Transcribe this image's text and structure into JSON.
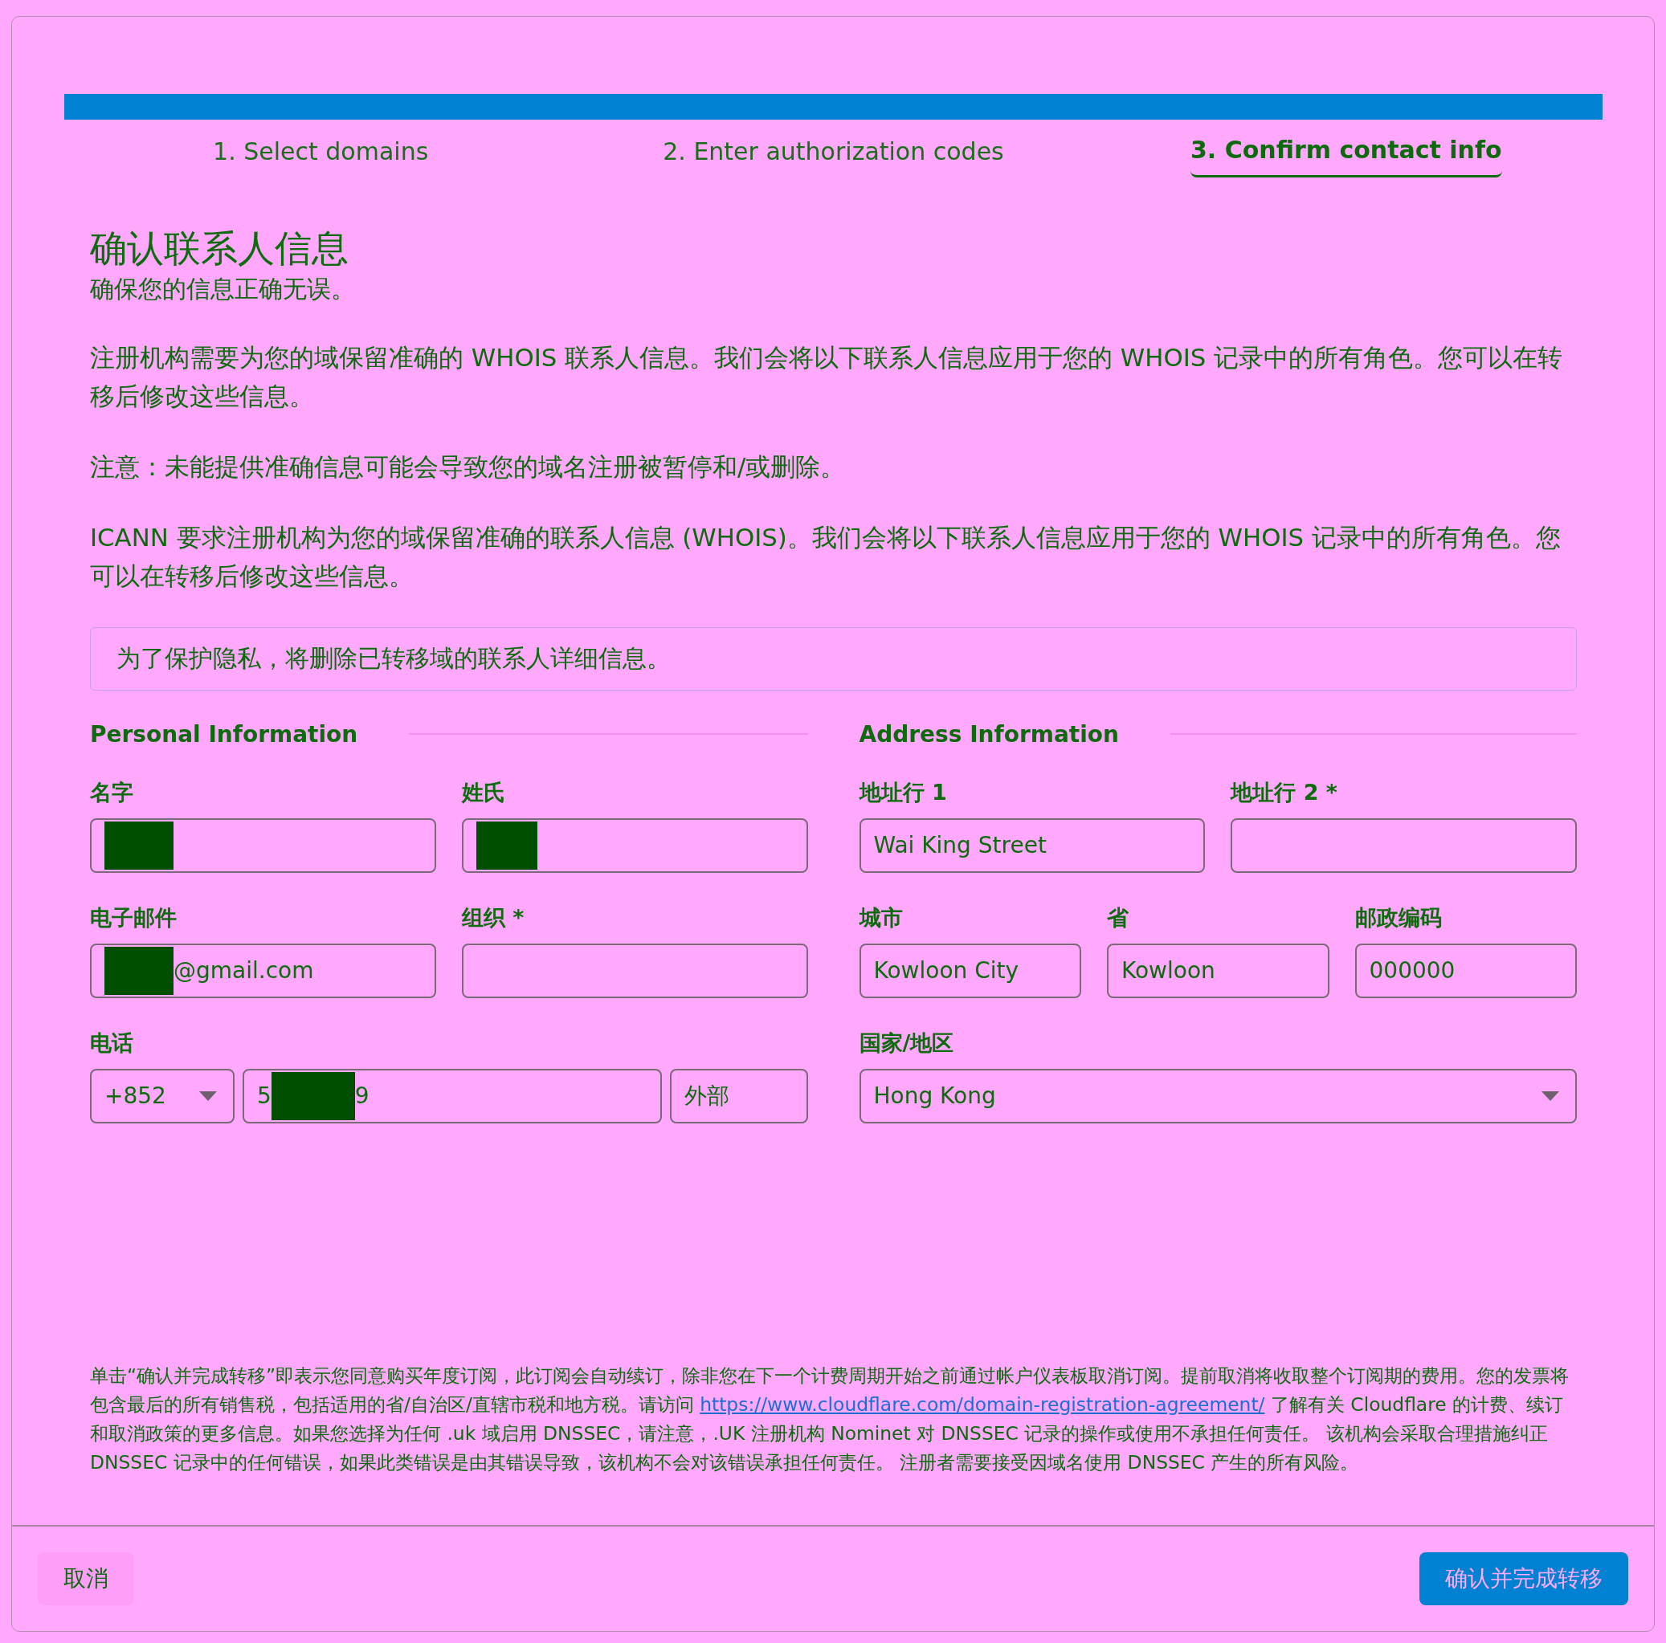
{
  "steps": [
    {
      "label": "1. Select domains",
      "selected": false
    },
    {
      "label": "2. Enter authorization codes",
      "selected": false
    },
    {
      "label": "3. Confirm contact info",
      "selected": true
    }
  ],
  "heading": "确认联系人信息",
  "subtitle": "确保您的信息正确无误。",
  "paragraphs": [
    "注册机构需要为您的域保留准确的 WHOIS 联系人信息。我们会将以下联系人信息应用于您的 WHOIS 记录中的所有角色。您可以在转移后修改这些信息。",
    "注意：未能提供准确信息可能会导致您的域名注册被暂停和/或删除。",
    "ICANN 要求注册机构为您的域保留准确的联系人信息 (WHOIS)。我们会将以下联系人信息应用于您的 WHOIS 记录中的所有角色。您可以在转移后修改这些信息。"
  ],
  "notice": "为了保护隐私，将删除已转移域的联系人详细信息。",
  "personal": {
    "title": "Personal Information",
    "first_name": {
      "label": "名字",
      "redacted": true
    },
    "last_name": {
      "label": "姓氏",
      "redacted": true
    },
    "email": {
      "label": "电子邮件",
      "redacted": true,
      "value": "@gmail.com"
    },
    "organization": {
      "label": "组织 *"
    },
    "phone": {
      "label": "电话",
      "country_code": "+852",
      "redacted": true,
      "visible_start": "5",
      "visible_end": "9",
      "extension_placeholder": "外部"
    }
  },
  "address": {
    "title": "Address Information",
    "line1": {
      "label": "地址行 1",
      "value": "Wai King Street"
    },
    "line2": {
      "label": "地址行 2 *"
    },
    "city": {
      "label": "城市",
      "value": "Kowloon City"
    },
    "province": {
      "label": "省",
      "value": "Kowloon"
    },
    "postal": {
      "label": "邮政编码",
      "value": "000000"
    },
    "country": {
      "label": "国家/地区",
      "value": "Hong Kong"
    }
  },
  "legal": {
    "before": "单击“确认并完成转移”即表示您同意购买年度订阅，此订阅会自动续订，除非您在下一个计费周期开始之前通过帐户仪表板取消订阅。提前取消将收取整个订阅期的费用。您的发票将包含最后的所有销售税，包括适用的省/自治区/直辖市税和地方税。请访问 ",
    "link": "https://www.cloudflare.com/domain-registration-agreement/",
    "after": " 了解有关 Cloudflare 的计费、续订和取消政策的更多信息。如果您选择为任何 .uk 域启用 DNSSEC，请注意，.UK 注册机构 Nominet 对 DNSSEC 记录的操作或使用不承担任何责任。 该机构会采取合理措施纠正 DNSSEC 记录中的任何错误，如果此类错误是由其错误导致，该机构不会对该错误承担任何责任。 注册者需要接受因域名使用 DNSSEC 产生的所有风险。"
  },
  "buttons": {
    "cancel": "取消",
    "confirm": "确认并完成转移"
  }
}
